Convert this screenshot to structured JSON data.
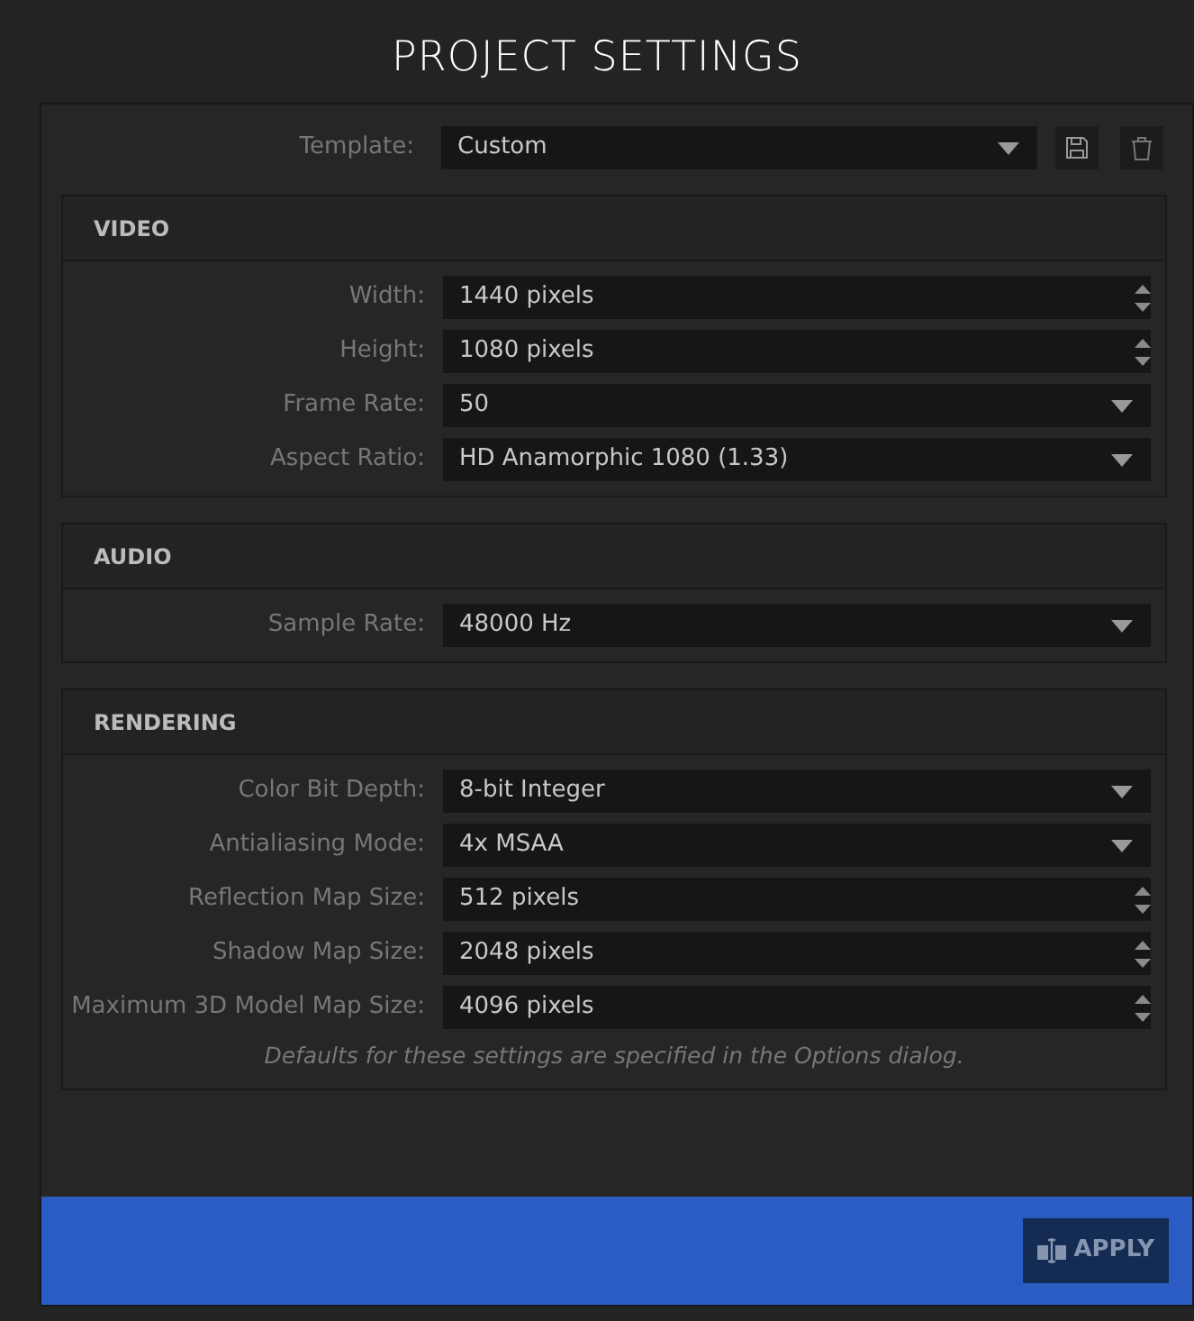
{
  "window": {
    "title": "PROJECT SETTINGS"
  },
  "template": {
    "label": "Template:",
    "value": "Custom"
  },
  "sections": [
    {
      "title": "VIDEO",
      "fields": [
        {
          "label": "Width:",
          "value": "1440 pixels",
          "kind": "spinner"
        },
        {
          "label": "Height:",
          "value": "1080 pixels",
          "kind": "spinner"
        },
        {
          "label": "Frame Rate:",
          "value": "50",
          "kind": "dropdown"
        },
        {
          "label": "Aspect Ratio:",
          "value": "HD Anamorphic 1080 (1.33)",
          "kind": "dropdown"
        }
      ]
    },
    {
      "title": "AUDIO",
      "fields": [
        {
          "label": "Sample Rate:",
          "value": "48000 Hz",
          "kind": "dropdown"
        }
      ]
    },
    {
      "title": "RENDERING",
      "fields": [
        {
          "label": "Color Bit Depth:",
          "value": "8-bit Integer",
          "kind": "dropdown"
        },
        {
          "label": "Antialiasing Mode:",
          "value": "4x MSAA",
          "kind": "dropdown"
        },
        {
          "label": "Reflection Map Size:",
          "value": "512 pixels",
          "kind": "spinner"
        },
        {
          "label": "Shadow Map Size:",
          "value": "2048 pixels",
          "kind": "spinner"
        },
        {
          "label": "Maximum 3D Model Map Size:",
          "value": "4096 pixels",
          "kind": "spinner"
        }
      ],
      "note": "Defaults for these settings are specified in the Options dialog."
    }
  ],
  "apply_button": "APPLY"
}
